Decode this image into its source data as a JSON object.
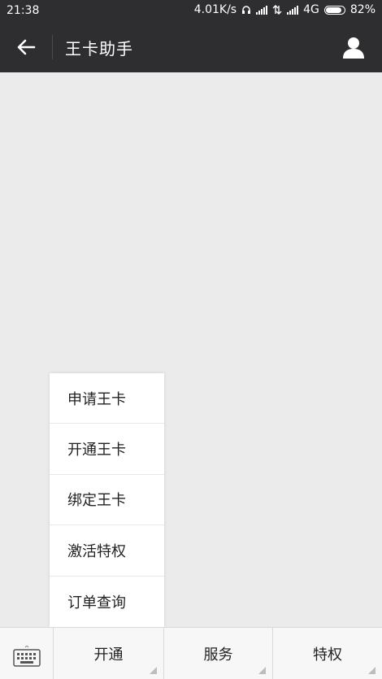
{
  "status_bar": {
    "time": "21:38",
    "net_speed": "4.01K/s",
    "network": "4G",
    "battery": "82%"
  },
  "header": {
    "title": "王卡助手"
  },
  "popup_menu": {
    "items": [
      {
        "label": "申请王卡"
      },
      {
        "label": "开通王卡"
      },
      {
        "label": "绑定王卡"
      },
      {
        "label": "激活特权"
      },
      {
        "label": "订单查询"
      }
    ]
  },
  "bottom_tabs": [
    {
      "label": "开通"
    },
    {
      "label": "服务"
    },
    {
      "label": "特权"
    }
  ],
  "colors": {
    "header_bg": "#2e2e30",
    "chat_bg": "#ebebeb",
    "menu_bg": "#ffffff",
    "bottom_bg": "#f7f7f7"
  },
  "icons": {
    "back": "back-arrow-icon",
    "profile": "user-profile-icon",
    "keyboard": "keyboard-icon"
  }
}
